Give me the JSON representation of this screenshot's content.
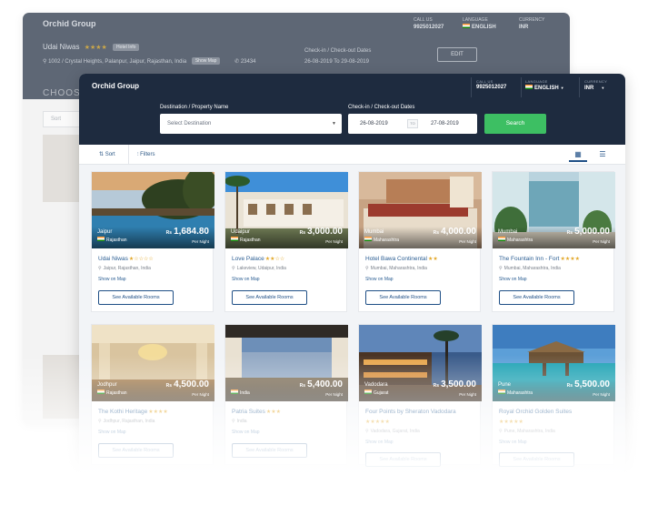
{
  "background_window": {
    "brand": "Orchid Group",
    "call_us_label": "CALL US",
    "call_us_value": "9925012027",
    "language_label": "LANGUAGE",
    "language_value": "ENGLISH",
    "currency_label": "CURRENCY",
    "currency_value": "INR",
    "hotel_name": "Udai Niwas",
    "hotel_stars": "★★★★",
    "hotel_info_pill": "Hotel Info",
    "address": "1002 / Crystal Heights, Palanpur, Jaipur, Rajasthan, India",
    "show_map": "Show Map",
    "phone": "23434",
    "checkin_label": "Check-in / Check-out Dates",
    "checkin_value": "26-08-2019",
    "to_label": "To",
    "checkout_value": "29-08-2019",
    "edit_label": "EDIT",
    "choose_label": "CHOOS",
    "sort_label": "Sort"
  },
  "header": {
    "brand": "Orchid Group",
    "call_us_label": "CALL US",
    "call_us_value": "9925012027",
    "language_label": "LANGUAGE",
    "language_value": "ENGLISH",
    "currency_label": "CURRENCY",
    "currency_value": "INR"
  },
  "search": {
    "destination_label": "Destination / Property Name",
    "destination_placeholder": "Select Destination",
    "dates_label": "Check-in / Check-out Dates",
    "checkin": "26-08-2019",
    "to_label": "TO",
    "checkout": "27-08-2019",
    "button": "Search"
  },
  "toolbar": {
    "sort_label": "Sort",
    "filters_label": "Filters",
    "grid_view_icon": "grid-icon",
    "list_view_icon": "list-icon"
  },
  "hotels": [
    {
      "city": "Jaipur",
      "state": "Rajasthan",
      "currency": "Rs",
      "price": "1,684.80",
      "per_night": "Per Night",
      "name": "Udai Niwas",
      "stars_filled": "★",
      "stars_empty": "☆☆☆☆",
      "location": "Jaipur, Rajasthan, India",
      "map": "Show on Map",
      "cta": "See Available Rooms"
    },
    {
      "city": "Udaipur",
      "state": "Rajasthan",
      "currency": "Rs",
      "price": "3,000.00",
      "per_night": "Per Night",
      "name": "Love Palace",
      "stars_filled": "★★",
      "stars_empty": "☆☆",
      "location": "Lakeview, Udaipur, India",
      "map": "Show on Map",
      "cta": "See Available Rooms"
    },
    {
      "city": "Mumbai",
      "state": "Maharashtra",
      "currency": "Rs",
      "price": "4,000.00",
      "per_night": "Per Night",
      "name": "Hotel Bawa Continental",
      "stars_filled": "★★",
      "stars_empty": "",
      "location": "Mumbai, Maharashtra, India",
      "map": "Show on Map",
      "cta": "See Available Rooms"
    },
    {
      "city": "Mumbai",
      "state": "Maharashtra",
      "currency": "Rs",
      "price": "5,000.00",
      "per_night": "Per Night",
      "name": "The Fountain Inn - Fort",
      "stars_filled": "★★★★",
      "stars_empty": "",
      "location": "Mumbai, Maharashtra, India",
      "map": "Show on Map",
      "cta": "See Available Rooms"
    },
    {
      "city": "Jodhpur",
      "state": "Rajasthan",
      "currency": "Rs",
      "price": "4,500.00",
      "per_night": "Per Night",
      "name": "The Kothi Heritage",
      "stars_filled": "★★★★",
      "stars_empty": "",
      "location": "Jodhpur, Rajasthan, India",
      "map": "Show on Map",
      "cta": "See Available Rooms"
    },
    {
      "city": "",
      "state": "India",
      "currency": "Rs",
      "price": "5,400.00",
      "per_night": "Per Night",
      "name": "Patria Suites",
      "stars_filled": "★★★",
      "stars_empty": "",
      "location": "India",
      "map": "Show on Map",
      "cta": "See Available Rooms"
    },
    {
      "city": "Vadodara",
      "state": "Gujarat",
      "currency": "Rs",
      "price": "3,500.00",
      "per_night": "Per Night",
      "name": "Four Points by Sheraton Vadodara",
      "stars_filled": "★★★★★",
      "stars_empty": "",
      "location": "Vadodara, Gujarat, India",
      "map": "Show on Map",
      "cta": "See Available Rooms"
    },
    {
      "city": "Pune",
      "state": "Maharashtra",
      "currency": "Rs",
      "price": "5,500.00",
      "per_night": "Per Night",
      "name": "Royal Orchid Golden Suites",
      "stars_filled": "★★★★★",
      "stars_empty": "",
      "location": "Pune, Maharashtra, India",
      "map": "Show on Map",
      "cta": "See Available Rooms"
    }
  ],
  "colors": {
    "header_bg": "#1e2b3f",
    "search_button": "#3dbf63",
    "link": "#2b5e93",
    "star": "#e3a82a"
  }
}
